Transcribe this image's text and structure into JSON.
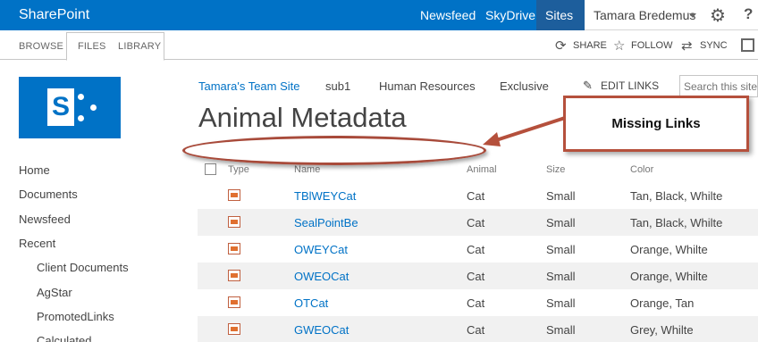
{
  "suitebar": {
    "brand": "SharePoint",
    "nav": [
      "Newsfeed",
      "SkyDrive",
      "Sites"
    ],
    "user": "Tamara Bredemus",
    "help": "?",
    "colors": {
      "bar": "#0072c6",
      "active_tab": "#1d5e9c"
    }
  },
  "ribbon": {
    "tabs": [
      "BROWSE",
      "FILES",
      "LIBRARY"
    ],
    "actions": [
      "SHARE",
      "FOLLOW",
      "SYNC"
    ]
  },
  "topnav": {
    "links": [
      "Tamara's Team Site",
      "sub1",
      "Human Resources",
      "Exclusive"
    ],
    "edit_links": "EDIT LINKS",
    "search_placeholder": "Search this site"
  },
  "page_title": "Animal Metadata",
  "quicklaunch": {
    "items": [
      "Home",
      "Documents",
      "Newsfeed",
      "Recent"
    ],
    "recent_items": [
      "Client Documents",
      "AgStar",
      "PromotedLinks",
      "Calculated"
    ]
  },
  "list": {
    "columns": [
      "Type",
      "Name",
      "Animal",
      "Size",
      "Color"
    ],
    "rows": [
      {
        "name": "TBlWEYCat",
        "animal": "Cat",
        "size": "Small",
        "color": "Tan, Black, Whilte"
      },
      {
        "name": "SealPointBe",
        "animal": "Cat",
        "size": "Small",
        "color": "Tan, Black, Whilte"
      },
      {
        "name": "OWEYCat",
        "animal": "Cat",
        "size": "Small",
        "color": "Orange, Whilte"
      },
      {
        "name": "OWEOCat",
        "animal": "Cat",
        "size": "Small",
        "color": "Orange, Whilte"
      },
      {
        "name": "OTCat",
        "animal": "Cat",
        "size": "Small",
        "color": "Orange, Tan"
      },
      {
        "name": "GWEOCat",
        "animal": "Cat",
        "size": "Small",
        "color": "Grey, Whilte"
      }
    ]
  },
  "annotation": {
    "callout": "Missing Links",
    "color": "#b5503c"
  }
}
